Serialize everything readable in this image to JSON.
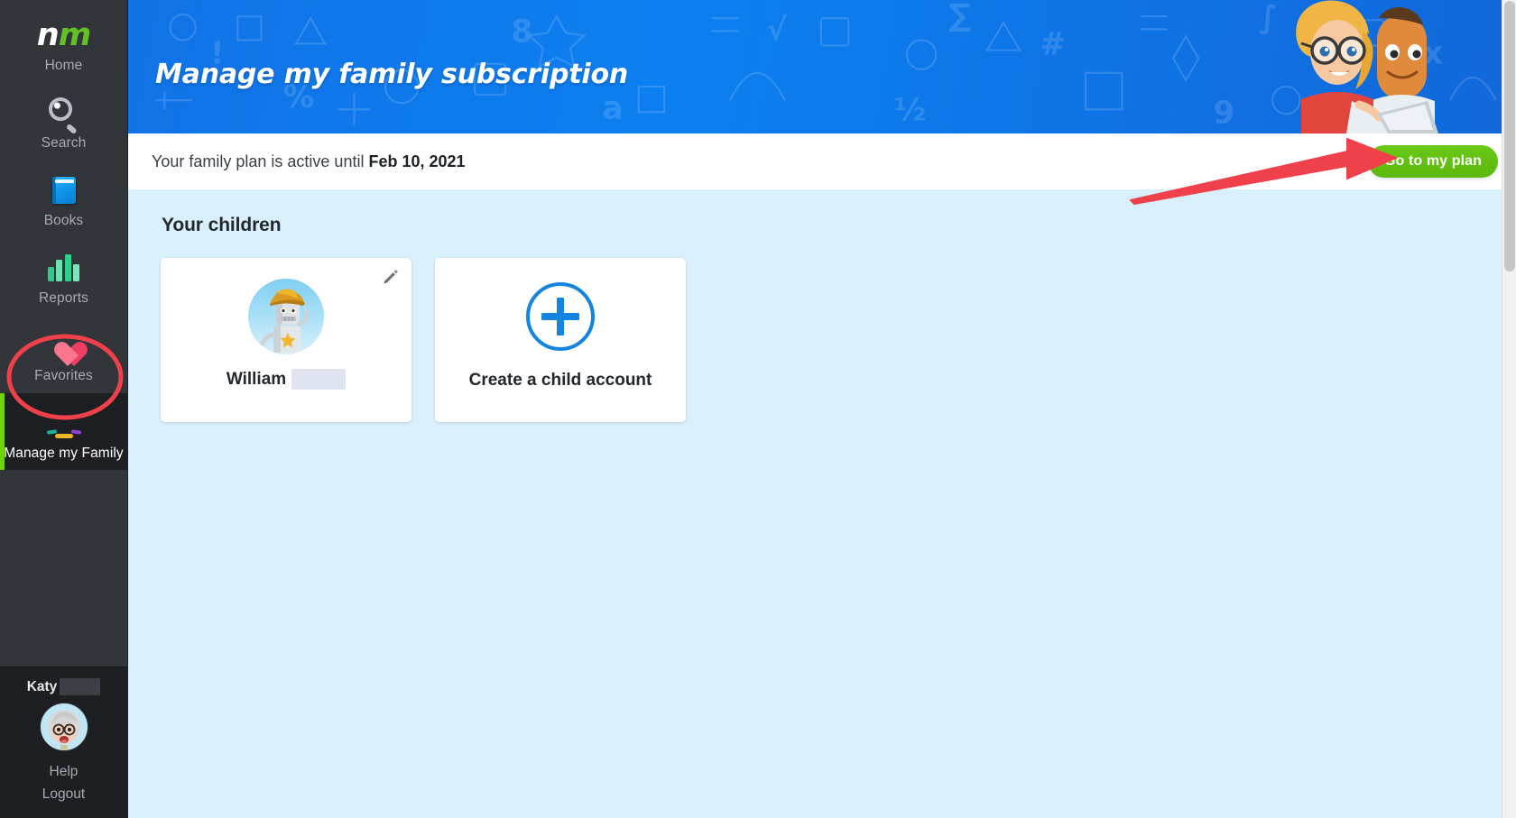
{
  "sidebar": {
    "logo": {
      "part1": "n",
      "part2": "m",
      "label": "Home",
      "icon": "nm-logo-icon"
    },
    "items": [
      {
        "id": "home",
        "label": "Home",
        "icon": "nm-logo-icon",
        "active": false
      },
      {
        "id": "search",
        "label": "Search",
        "icon": "search-icon",
        "active": false
      },
      {
        "id": "books",
        "label": "Books",
        "icon": "book-icon",
        "active": false
      },
      {
        "id": "reports",
        "label": "Reports",
        "icon": "bar-chart-icon",
        "active": false
      },
      {
        "id": "favorites",
        "label": "Favorites",
        "icon": "heart-icon",
        "active": false
      },
      {
        "id": "manage-family",
        "label": "Manage my Family",
        "icon": "family-icon",
        "active": true
      }
    ],
    "footer": {
      "user_name": "Katy",
      "user_surname_redacted": "",
      "avatar": "scientist-avatar",
      "help_label": "Help",
      "logout_label": "Logout"
    }
  },
  "hero": {
    "title": "Manage my family subscription",
    "illustration": "parents-illustration",
    "bg_color": "#0d7ff0"
  },
  "plan_bar": {
    "text_prefix": "Your family plan is active until",
    "date": "Feb 10, 2021",
    "button_label": "Go to my plan",
    "button_color": "#5cb80e"
  },
  "content": {
    "heading": "Your children",
    "child_cards": [
      {
        "name": "William",
        "surname_redacted": "",
        "avatar": "robot-cowboy-avatar",
        "edit_icon": "pencil-icon"
      }
    ],
    "create_card": {
      "label": "Create a child account",
      "icon": "plus-circle-icon",
      "accent_color": "#1384e0"
    }
  },
  "annotations": {
    "arrow": {
      "name": "red-arrow-annotation",
      "color": "#f0404a",
      "points_to": "Go to my plan"
    },
    "ellipse": {
      "name": "red-ellipse-annotation",
      "color": "#f0404a",
      "encircles": "Manage my Family"
    }
  }
}
